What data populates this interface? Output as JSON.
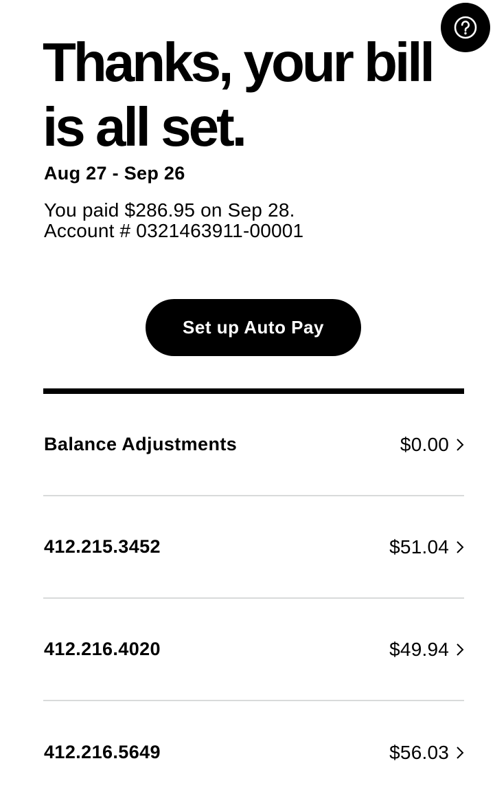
{
  "help": {
    "icon": "question-icon"
  },
  "headline": "Thanks, your bill is all set.",
  "bill": {
    "date_range": "Aug 27 - Sep 26",
    "paid_text": "You paid $286.95 on Sep 28.",
    "account_text": "Account # 0321463911-00001"
  },
  "autopay": {
    "label": "Set up Auto Pay"
  },
  "rows": [
    {
      "label": "Balance Adjustments",
      "amount": "$0.00"
    },
    {
      "label": "412.215.3452",
      "amount": "$51.04"
    },
    {
      "label": "412.216.4020",
      "amount": "$49.94"
    },
    {
      "label": "412.216.5649",
      "amount": "$56.03"
    }
  ],
  "colors": {
    "primary": "#000000",
    "background": "#ffffff",
    "divider": "#d8dada"
  }
}
